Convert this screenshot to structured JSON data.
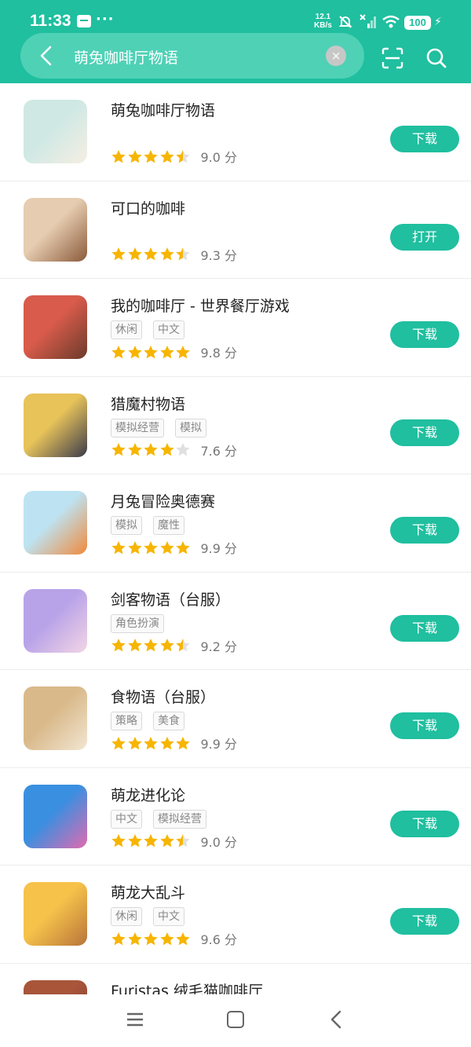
{
  "status_bar": {
    "time": "11:33",
    "more": "···",
    "speed_value": "12.1",
    "speed_unit": "KB/s",
    "battery": "100"
  },
  "search": {
    "query": "萌兔咖啡厅物语",
    "clear": "×"
  },
  "button_color": "#1fbf9f",
  "star_color": "#f7b500",
  "apps": [
    {
      "title": "萌兔咖啡厅物语",
      "tags": [],
      "stars": 4.5,
      "score": "9.0 分",
      "action": "下载",
      "icon": "bunny-cafe-icon",
      "colors": [
        "#cfe8e4",
        "#f5efe3"
      ]
    },
    {
      "title": "可口的咖啡",
      "tags": [],
      "stars": 4.5,
      "score": "9.3 分",
      "action": "打开",
      "icon": "latte-art-icon",
      "colors": [
        "#e6ccb0",
        "#8a5a3a"
      ]
    },
    {
      "title": "我的咖啡厅 - 世界餐厅游戏",
      "tags": [
        "休闲",
        "中文"
      ],
      "stars": 5,
      "score": "9.8 分",
      "action": "下载",
      "icon": "coffee-cup-icon",
      "colors": [
        "#d85b4b",
        "#6b3b2b"
      ]
    },
    {
      "title": "猎魔村物语",
      "tags": [
        "模拟经营",
        "模拟"
      ],
      "stars": 4,
      "score": "7.6 分",
      "action": "下载",
      "icon": "pixel-hero-icon",
      "colors": [
        "#e8c35a",
        "#3b3b4b"
      ]
    },
    {
      "title": "月兔冒险奥德赛",
      "tags": [
        "模拟",
        "魔性"
      ],
      "stars": 5,
      "score": "9.9 分",
      "action": "下载",
      "icon": "moon-rabbit-icon",
      "colors": [
        "#bde3f2",
        "#f08a3c"
      ]
    },
    {
      "title": "剑客物语（台服）",
      "tags": [
        "角色扮演"
      ],
      "stars": 4.5,
      "score": "9.2 分",
      "action": "下载",
      "icon": "swordsman-girl-icon",
      "colors": [
        "#b8a3e8",
        "#f3d5e5"
      ]
    },
    {
      "title": "食物语（台服）",
      "tags": [
        "策略",
        "美食"
      ],
      "stars": 5,
      "score": "9.9 分",
      "action": "下载",
      "icon": "food-story-icon",
      "colors": [
        "#d9b98a",
        "#f2e6d2"
      ]
    },
    {
      "title": "萌龙进化论",
      "tags": [
        "中文",
        "模拟经营"
      ],
      "stars": 4.5,
      "score": "9.0 分",
      "action": "下载",
      "icon": "dragon-egg-icon",
      "colors": [
        "#3a8fe0",
        "#e06bb0"
      ]
    },
    {
      "title": "萌龙大乱斗",
      "tags": [
        "休闲",
        "中文"
      ],
      "stars": 5,
      "score": "9.6 分",
      "action": "下载",
      "icon": "cookie-dragon-icon",
      "colors": [
        "#f6c24a",
        "#b8743a"
      ]
    },
    {
      "title": "Furistas 绒毛猫咖啡厅",
      "tags": [],
      "stars": 0,
      "score": "",
      "action": "",
      "icon": "cat-cafe-icon",
      "colors": [
        "#a8553a",
        "#7a3a2a"
      ]
    }
  ]
}
